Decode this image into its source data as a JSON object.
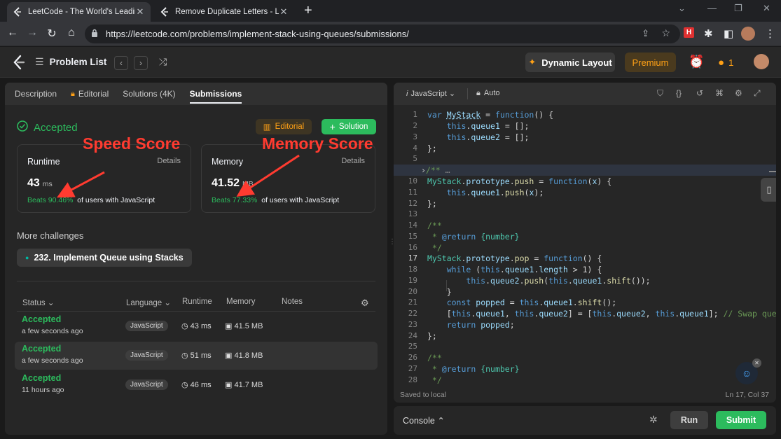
{
  "browser": {
    "tabs": [
      {
        "title": "LeetCode - The World's Leading Online Programming Learning Platform"
      },
      {
        "title": "Remove Duplicate Letters - LeetCode"
      }
    ],
    "url": "https://leetcode.com/problems/implement-stack-using-queues/submissions/",
    "window_controls": {
      "chevron": "⌄",
      "minimize": "—",
      "maximize": "❐",
      "close": "✕"
    }
  },
  "lc_nav": {
    "problem_list": "Problem List",
    "dynamic_layout": "Dynamic Layout",
    "premium": "Premium",
    "streak": "1"
  },
  "left_panel": {
    "tabs": [
      "Description",
      "Editorial",
      "Solutions (4K)",
      "Submissions"
    ],
    "status": "Accepted",
    "editorial_btn": "Editorial",
    "solution_btn": "Solution",
    "runtime_card": {
      "label": "Runtime",
      "details": "Details",
      "value": "43",
      "unit": "ms",
      "beats": "Beats 90.46%",
      "suffix": "of users with JavaScript"
    },
    "memory_card": {
      "label": "Memory",
      "details": "Details",
      "value": "41.52",
      "unit": "MB",
      "beats": "Beats 77.33%",
      "suffix": "of users with JavaScript"
    },
    "annotations": {
      "speed": "Speed Score",
      "memory": "Memory Score"
    },
    "more_challenges": "More challenges",
    "challenge": "232. Implement Queue using Stacks",
    "table_headers": {
      "status": "Status",
      "language": "Language",
      "runtime": "Runtime",
      "memory": "Memory",
      "notes": "Notes"
    },
    "rows": [
      {
        "status": "Accepted",
        "time": "a few seconds ago",
        "lang": "JavaScript",
        "runtime": "43 ms",
        "memory": "41.5 MB"
      },
      {
        "status": "Accepted",
        "time": "a few seconds ago",
        "lang": "JavaScript",
        "runtime": "51 ms",
        "memory": "41.8 MB"
      },
      {
        "status": "Accepted",
        "time": "11 hours ago",
        "lang": "JavaScript",
        "runtime": "46 ms",
        "memory": "41.7 MB"
      }
    ]
  },
  "editor": {
    "language": "JavaScript",
    "mode": "Auto",
    "line_numbers": [
      "1",
      "2",
      "3",
      "4",
      "5",
      "6",
      "10",
      "11",
      "12",
      "13",
      "14",
      "15",
      "16",
      "17",
      "18",
      "19",
      "20",
      "21",
      "22",
      "23",
      "24",
      "25",
      "26",
      "27",
      "28"
    ],
    "saved": "Saved to local",
    "cursor": "Ln 17, Col 37"
  },
  "console": {
    "label": "Console",
    "run": "Run",
    "submit": "Submit"
  },
  "colors": {
    "accent_green": "#2cbb5d",
    "annotation_red": "#ff3b30",
    "premium": "#ffa116"
  }
}
